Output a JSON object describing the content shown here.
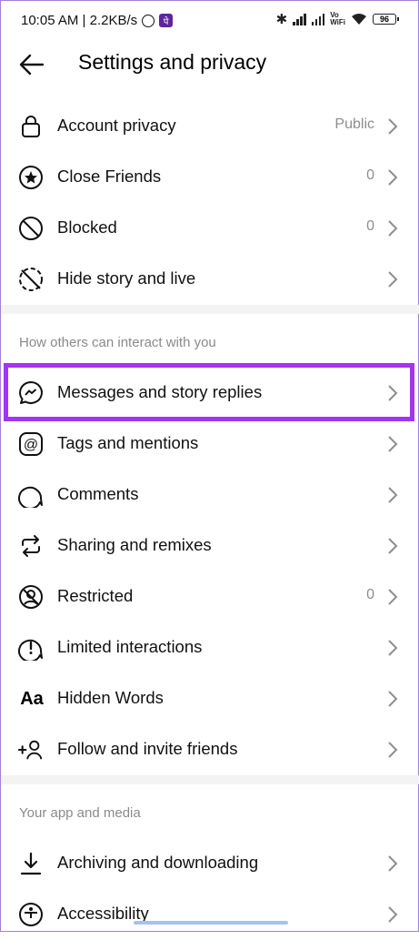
{
  "status": {
    "time": "10:05 AM | 2.2KB/s",
    "pe_badge": "पे",
    "vowifi": "Vo\nWiFi",
    "battery": "96"
  },
  "header": {
    "title": "Settings and privacy"
  },
  "rows": [
    {
      "label": "Account privacy",
      "value": "Public"
    },
    {
      "label": "Close Friends",
      "value": "0"
    },
    {
      "label": "Blocked",
      "value": "0"
    },
    {
      "label": "Hide story and live",
      "value": ""
    },
    {
      "label": "Messages and story replies",
      "value": ""
    },
    {
      "label": "Tags and mentions",
      "value": ""
    },
    {
      "label": "Comments",
      "value": ""
    },
    {
      "label": "Sharing and remixes",
      "value": ""
    },
    {
      "label": "Restricted",
      "value": "0"
    },
    {
      "label": "Limited interactions",
      "value": ""
    },
    {
      "label": "Hidden Words",
      "value": ""
    },
    {
      "label": "Follow and invite friends",
      "value": ""
    },
    {
      "label": "Archiving and downloading",
      "value": ""
    },
    {
      "label": "Accessibility",
      "value": ""
    }
  ],
  "sections": {
    "interact": "How others can interact with you",
    "app_media": "Your app and media"
  },
  "icons": {
    "account_privacy": "lock-icon",
    "close_friends": "star-circle-icon",
    "blocked": "block-icon",
    "hide_story": "hide-story-icon",
    "messages": "messenger-icon",
    "tags": "at-sign-icon",
    "comments": "comment-icon",
    "sharing": "repost-icon",
    "restricted": "restricted-icon",
    "limited": "alert-circle-icon",
    "hidden_words_glyph": "Aa",
    "follow": "add-person-icon",
    "archiving": "download-icon"
  },
  "colors": {
    "highlight": "#a433f2",
    "secondary_text": "#8e8e8e"
  }
}
